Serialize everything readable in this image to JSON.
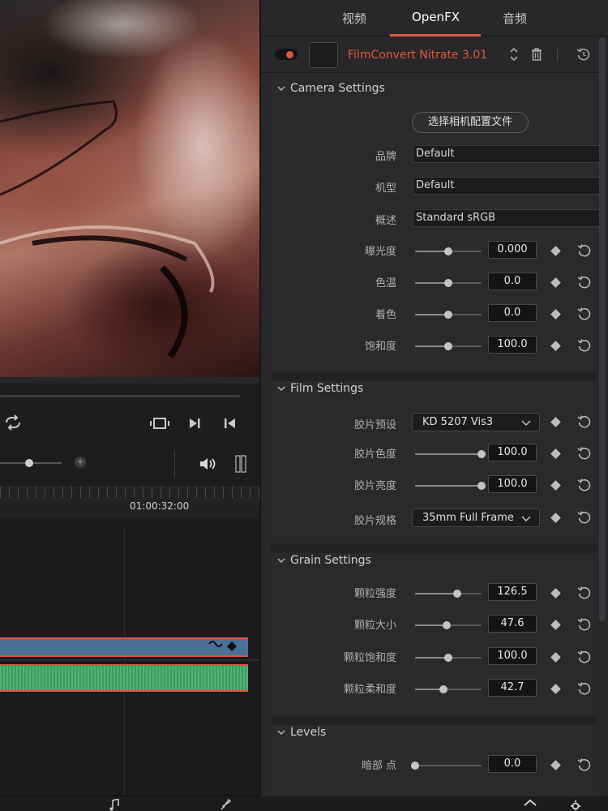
{
  "tabs": [
    {
      "label": "视频",
      "active": false
    },
    {
      "label": "OpenFX",
      "active": true
    },
    {
      "label": "音频",
      "active": false
    }
  ],
  "effect": {
    "name": "FilmConvert Nitrate 3.01",
    "enabled": true,
    "icons": [
      "move-up-down-icon",
      "trash-icon",
      "reset-icon"
    ]
  },
  "timeline": {
    "timecode": "01:00:32:00"
  },
  "camera": {
    "title": "Camera Settings",
    "profile_button": "选择相机配置文件",
    "fields": [
      {
        "label": "品牌",
        "value": "Default"
      },
      {
        "label": "机型",
        "value": "Default"
      },
      {
        "label": "概述",
        "value": "Standard sRGB"
      }
    ],
    "sliders": [
      {
        "label": "曝光度",
        "value": "0.000",
        "pos": 0.5
      },
      {
        "label": "色温",
        "value": "0.0",
        "pos": 0.5
      },
      {
        "label": "着色",
        "value": "0.0",
        "pos": 0.5
      },
      {
        "label": "饱和度",
        "value": "100.0",
        "pos": 0.5
      }
    ]
  },
  "film": {
    "title": "Film Settings",
    "preset_label": "胶片预设",
    "preset_value": "KD 5207 Vis3",
    "sliders": [
      {
        "label": "胶片色度",
        "value": "100.0",
        "pos": 1.0
      },
      {
        "label": "胶片亮度",
        "value": "100.0",
        "pos": 1.0
      }
    ],
    "format_label": "胶片规格",
    "format_value": "35mm Full Frame"
  },
  "grain": {
    "title": "Grain Settings",
    "sliders": [
      {
        "label": "颗粒强度",
        "value": "126.5",
        "pos": 0.63
      },
      {
        "label": "颗粒大小",
        "value": "47.6",
        "pos": 0.48
      },
      {
        "label": "颗粒饱和度",
        "value": "100.0",
        "pos": 0.5
      },
      {
        "label": "颗粒柔和度",
        "value": "42.7",
        "pos": 0.43
      }
    ]
  },
  "levels": {
    "title": "Levels",
    "sliders": [
      {
        "label": "暗部 点",
        "value": "0.0",
        "pos": 0.0
      }
    ]
  },
  "colors": {
    "accent": "#e2553a",
    "video_track": "#4c6f96",
    "audio_track": "#3f9a62"
  }
}
